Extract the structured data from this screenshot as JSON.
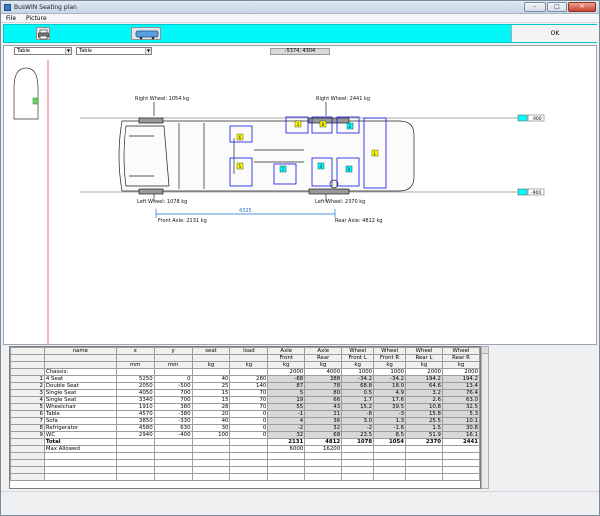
{
  "window": {
    "title": "BusWIN Seating plan",
    "min": "–",
    "max": "□",
    "close": "✕"
  },
  "menu": [
    "File",
    "Picture"
  ],
  "toolbar": {
    "ok_label": "OK"
  },
  "canvas": {
    "dropdown_left": "Table",
    "dropdown_right": "Table",
    "coords": "-5374, 4304",
    "right_wheel_front": "Right Wheel: 1054 kg",
    "right_wheel_rear": "Right Wheel: 2441 kg",
    "left_wheel_front": "Left Wheel: 1078 kg",
    "left_wheel_rear": "Left Wheel: 2370 kg",
    "dimension": "4325",
    "front_axle": "Front Axle: 2131 kg",
    "rear_axle": "Rear Axle: 4812 kg",
    "top_marker": "900",
    "bottom_marker": "-900",
    "seat_labels": [
      "1",
      "2",
      "3",
      "4",
      "5",
      "6",
      "7",
      "8",
      "9"
    ]
  },
  "grid": {
    "header1": [
      "name",
      "x",
      "y",
      "seat",
      "load",
      "Axle",
      "Axle",
      "Wheel",
      "Wheel",
      "Wheel",
      "Wheel"
    ],
    "header2": [
      "",
      "",
      "",
      "",
      "",
      "Front",
      "Rear",
      "Front L",
      "Front R",
      "Rear L",
      "Rear R"
    ],
    "units": [
      "",
      "mm",
      "mm",
      "kg",
      "kg",
      "kg",
      "kg",
      "kg",
      "kg",
      "kg",
      "kg"
    ],
    "rows": [
      {
        "idx": "",
        "cells": [
          "Chassis:",
          "",
          "",
          "",
          "",
          "2000",
          "4000",
          "1000",
          "1000",
          "2000",
          "2000"
        ]
      },
      {
        "idx": "1",
        "cells": [
          "4 Seat",
          "5250",
          "0",
          "40",
          "280",
          "-68",
          "388",
          "-34.2",
          "-34.2",
          "194.2",
          "194.2"
        ]
      },
      {
        "idx": "2",
        "cells": [
          "Double Seat",
          "2050",
          "-500",
          "25",
          "140",
          "87",
          "78",
          "68.8",
          "18.0",
          "64.6",
          "13.4"
        ]
      },
      {
        "idx": "3",
        "cells": [
          "Single Seat",
          "4050",
          "700",
          "15",
          "70",
          "5",
          "80",
          "0.5",
          "4.9",
          "3.2",
          "76.4"
        ]
      },
      {
        "idx": "4",
        "cells": [
          "Single Seat",
          "3340",
          "700",
          "15",
          "70",
          "19",
          "66",
          "1.7",
          "17.6",
          "2.6",
          "63.0"
        ]
      },
      {
        "idx": "5",
        "cells": [
          "Wheelchair",
          "1910",
          "380",
          "28",
          "70",
          "55",
          "43",
          "15.2",
          "39.5",
          "10.8",
          "32.5"
        ]
      },
      {
        "idx": "6",
        "cells": [
          "Table",
          "4570",
          "-380",
          "20",
          "0",
          "-1",
          "21",
          "-8",
          "-3",
          "15.8",
          "5.3"
        ]
      },
      {
        "idx": "7",
        "cells": [
          "Sofa",
          "3850",
          "-330",
          "40",
          "0",
          "4",
          "36",
          "3.0",
          "1.3",
          "25.5",
          "10.1"
        ]
      },
      {
        "idx": "8",
        "cells": [
          "Refrigerator",
          "4580",
          "630",
          "30",
          "0",
          "-2",
          "32",
          "-2",
          "-1.6",
          "1.5",
          "30.8"
        ]
      },
      {
        "idx": "9",
        "cells": [
          "WC",
          "2940",
          "-400",
          "100",
          "0",
          "32",
          "68",
          "23.5",
          "8.5",
          "51.9",
          "16.1"
        ]
      },
      {
        "idx": "",
        "cells": [
          "Total",
          "",
          "",
          "",
          "",
          "2131",
          "4812",
          "1078",
          "1054",
          "2370",
          "2441"
        ],
        "bold": true
      },
      {
        "idx": "",
        "cells": [
          "Max Allowed",
          "",
          "",
          "",
          "",
          "6000",
          "16200",
          "",
          "",
          "",
          ""
        ]
      }
    ]
  }
}
